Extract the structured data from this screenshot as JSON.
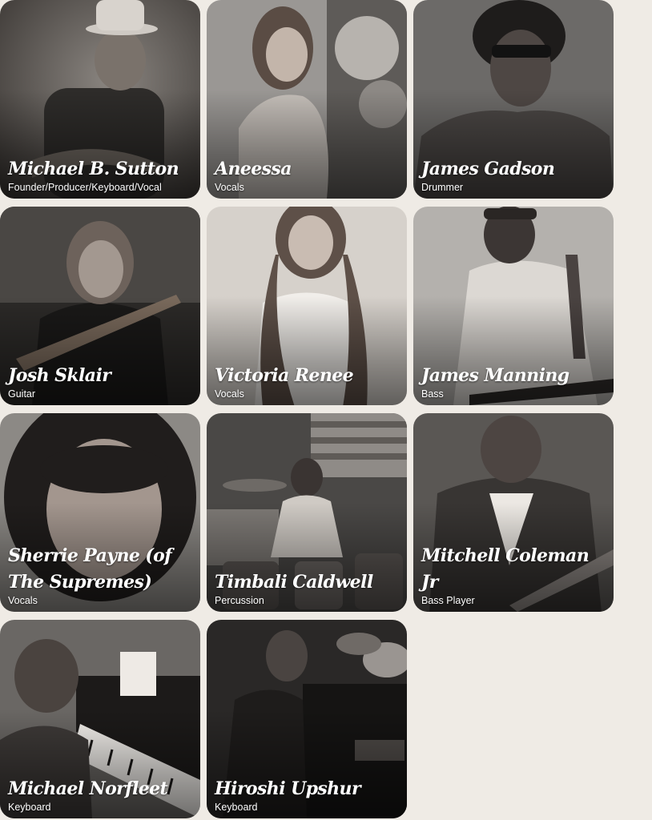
{
  "members": [
    {
      "name": "Michael B. Sutton",
      "role": "Founder/Producer/Keyboard/Vocal"
    },
    {
      "name": "Aneessa",
      "role": "Vocals"
    },
    {
      "name": "James Gadson",
      "role": "Drummer"
    },
    {
      "name": "Josh Sklair",
      "role": "Guitar"
    },
    {
      "name": "Victoria Renee",
      "role": "Vocals"
    },
    {
      "name": "James Manning",
      "role": "Bass"
    },
    {
      "name": "Sherrie Payne (of The Supremes)",
      "role": "Vocals"
    },
    {
      "name": "Timbali Caldwell",
      "role": "Percussion"
    },
    {
      "name": "Mitchell Coleman Jr",
      "role": "Bass Player"
    },
    {
      "name": "Michael Norfleet",
      "role": "Keyboard"
    },
    {
      "name": "Hiroshi Upshur",
      "role": "Keyboard"
    }
  ],
  "colors": {
    "page_background": "#efebe5",
    "caption_text": "#ffffff"
  }
}
